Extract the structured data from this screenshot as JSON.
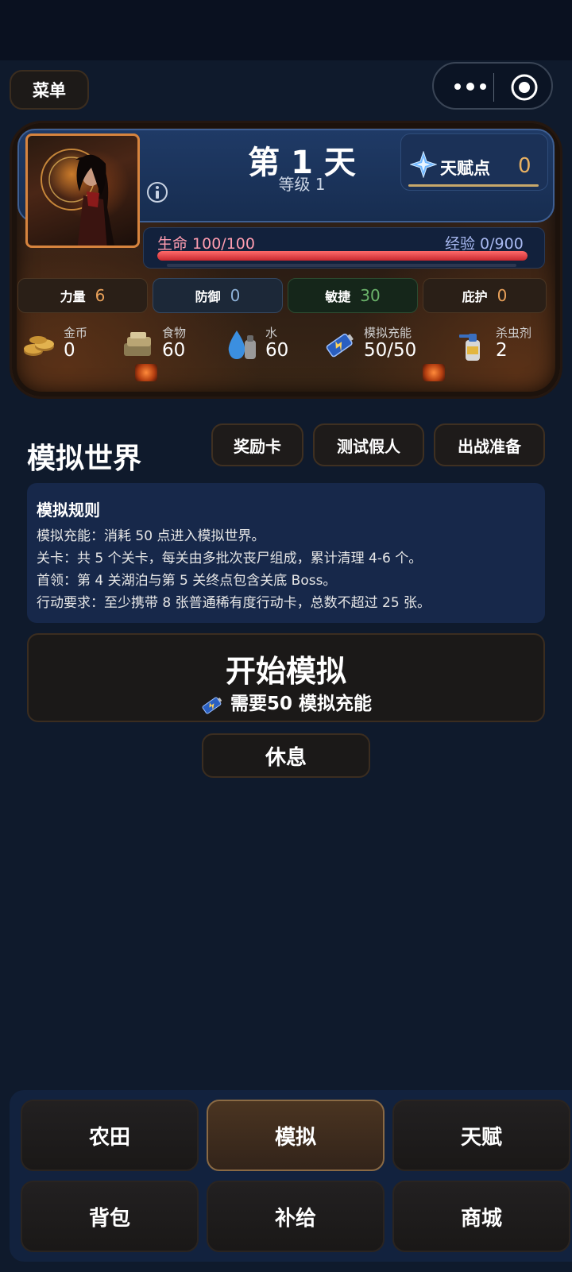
{
  "topbar": {
    "menu_label": "菜单"
  },
  "player": {
    "day_title": "第 1 天",
    "level": "等级 1",
    "talent": {
      "label": "天赋点",
      "value": "0"
    },
    "hp": {
      "label": "生命 100/100",
      "fraction": 1.0
    },
    "xp": {
      "label": "经验 0/900",
      "fraction": 0.0
    },
    "stats": [
      {
        "label": "力量",
        "value": "6",
        "color": "#e9a15a"
      },
      {
        "label": "防御",
        "value": "0",
        "color": "#8fb3d9"
      },
      {
        "label": "敏捷",
        "value": "30",
        "color": "#6ab36a"
      },
      {
        "label": "庇护",
        "value": "0",
        "color": "#e9a15a"
      }
    ],
    "resources": [
      {
        "label": "金币",
        "value": "0",
        "icon": "coins-icon"
      },
      {
        "label": "食物",
        "value": "60",
        "icon": "food-icon"
      },
      {
        "label": "水",
        "value": "60",
        "icon": "water-icon"
      },
      {
        "label": "模拟充能",
        "value": "50/50",
        "icon": "battery-icon"
      },
      {
        "label": "杀虫剂",
        "value": "2",
        "icon": "spray-icon"
      }
    ]
  },
  "world": {
    "title": "模拟世界",
    "chips": [
      "奖励卡",
      "测试假人",
      "出战准备"
    ],
    "rules_title": "模拟规则",
    "rules": [
      "模拟充能：消耗 50 点进入模拟世界。",
      "关卡：共 5 个关卡，每关由多批次丧尸组成，累计清理 4-6 个。",
      "首领：第 4 关湖泊与第 5 关终点包含关底 Boss。",
      "行动要求：至少携带 8 张普通稀有度行动卡，总数不超过 25 张。"
    ],
    "start_title": "开始模拟",
    "start_sub": "需要50 模拟充能",
    "rest_label": "休息"
  },
  "nav": {
    "items": [
      "农田",
      "模拟",
      "天赋",
      "背包",
      "补给",
      "商城"
    ],
    "active": "模拟"
  }
}
